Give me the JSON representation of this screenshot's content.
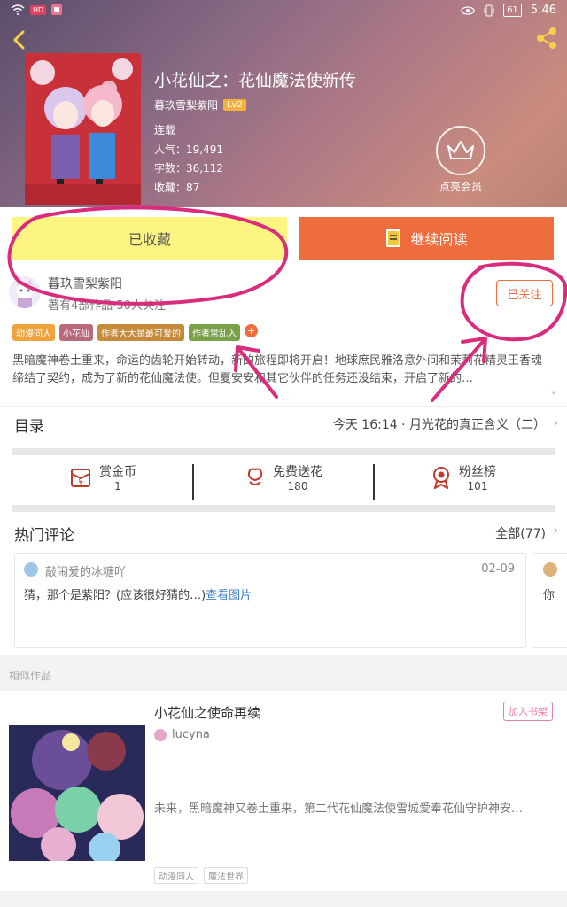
{
  "statusbar": {
    "battery": "61",
    "time": "5:46",
    "badge": "HD"
  },
  "header": {
    "title": "小花仙之：花仙魔法使新传",
    "author": "暮玖雪梨紫阳",
    "level": "Lv2",
    "status": "连载",
    "popularity": "人气：19,491",
    "wordcount": "字数：36,112",
    "favorites": "收藏：87",
    "vip_label": "点亮会员"
  },
  "actions": {
    "collected_label": "已收藏",
    "continue_label": "继续阅读"
  },
  "author_section": {
    "name": "暮玖雪梨紫阳",
    "stats": "著有4部作品·50人关注",
    "follow_label": "已关注"
  },
  "tags": [
    {
      "label": "动漫同人",
      "color": "#f0a23c"
    },
    {
      "label": "小花仙",
      "color": "#b86a7a"
    },
    {
      "label": "作者大大是最可爱的",
      "color": "#c58a3a"
    },
    {
      "label": "作者常乱入",
      "color": "#7aa04a"
    }
  ],
  "description": "黑暗魔神卷土重来，命运的齿轮开始转动，新的旅程即将开启！地球庶民雅洛意外间和茉莉花精灵王香魂缔结了契约，成为了新的花仙魔法使。但夏安安和其它伙伴的任务还没结束，开启了新的…",
  "toc": {
    "label": "目录",
    "latest": "今天 16:14 · 月光花的真正含义（二）"
  },
  "stats": [
    {
      "label": "赏金币",
      "value": "1"
    },
    {
      "label": "免费送花",
      "value": "180"
    },
    {
      "label": "粉丝榜",
      "value": "101"
    }
  ],
  "hot_comments": {
    "title": "热门评论",
    "all_label": "全部(77)",
    "items": [
      {
        "user": "敲闹爱的冰糖吖",
        "date": "02-09",
        "text": "猜，那个是紫阳？(应该很好猜的…)",
        "link": "查看图片"
      },
      {
        "text": "你"
      }
    ]
  },
  "similar": {
    "label": "相似作品",
    "items": [
      {
        "title": "小花仙之使命再续",
        "add_label": "加入书架",
        "author": "lucyna",
        "desc": "未来，黑暗魔神又卷土重来，第二代花仙魔法使雪城爱奉花仙守护神安…",
        "tags": [
          "动漫同人",
          "魔法世界"
        ]
      }
    ]
  }
}
